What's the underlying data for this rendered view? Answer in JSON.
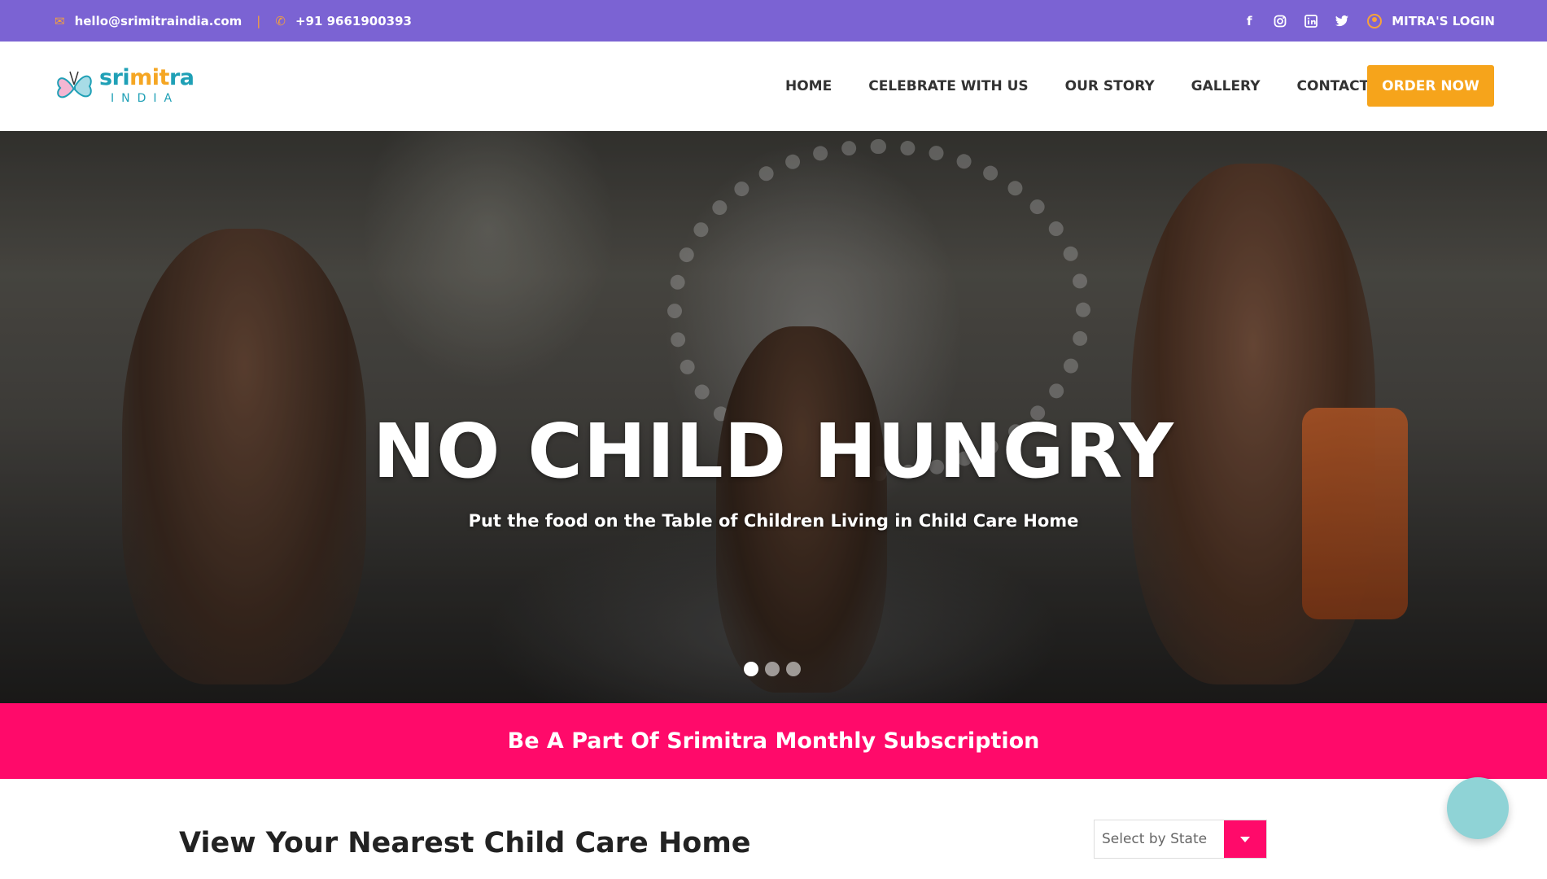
{
  "topbar": {
    "email": "hello@srimitraindia.com",
    "email_icon": "mail-icon",
    "separator": "|",
    "phone": "+91 9661900393",
    "phone_icon": "phone-icon",
    "social": [
      "facebook-icon",
      "instagram-icon",
      "linkedin-icon",
      "twitter-icon"
    ],
    "login_label": "MITRA'S LOGIN"
  },
  "logo": {
    "name_a": "sri",
    "name_b": "mit",
    "name_c": "ra",
    "sub": "INDIA"
  },
  "nav": {
    "items": [
      "HOME",
      "CELEBRATE WITH US",
      "OUR STORY",
      "GALLERY",
      "CONTACT"
    ],
    "order_label": "ORDER NOW"
  },
  "hero": {
    "title": "NO CHILD HUNGRY",
    "tagline": "Put the food on the Table of Children Living in Child Care Home",
    "slides": 3,
    "active_slide": 1
  },
  "band": {
    "text": "Be A Part Of Srimitra Monthly Subscription"
  },
  "section": {
    "title": "View Your Nearest Child Care Home",
    "select_value": "Select by State"
  },
  "colors": {
    "topbar": "#7b63d3",
    "accent_orange": "#f6a41b",
    "accent_pink": "#ff0a6a",
    "chat": "#8fd3d6"
  }
}
